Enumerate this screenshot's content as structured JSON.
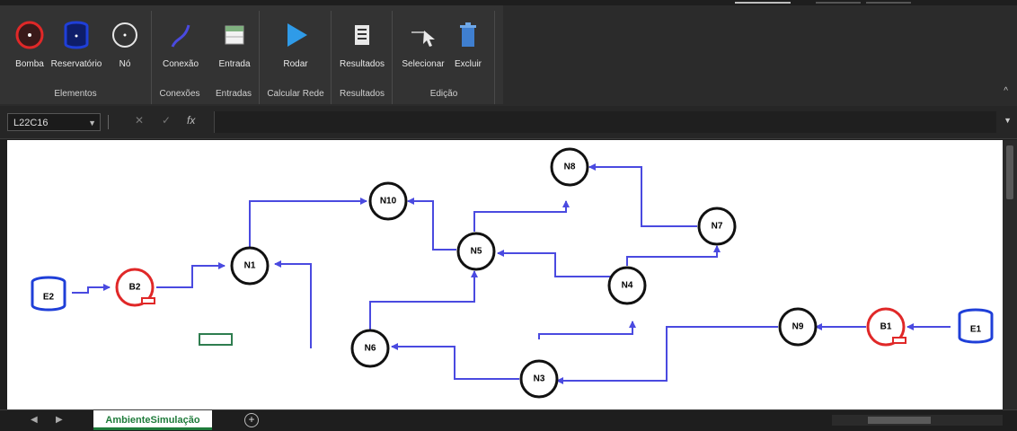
{
  "ribbon": {
    "groups": [
      {
        "label": "Elementos",
        "buttons": [
          {
            "label": "Bomba",
            "icon": "pump-icon"
          },
          {
            "label": "Reservatório",
            "icon": "reservoir-icon"
          },
          {
            "label": "Nó",
            "icon": "node-icon"
          }
        ]
      },
      {
        "label": "Conexões",
        "buttons": [
          {
            "label": "Conexão",
            "icon": "connection-icon"
          }
        ]
      },
      {
        "label": "Entradas",
        "buttons": [
          {
            "label": "Entrada",
            "icon": "input-table-icon"
          }
        ]
      },
      {
        "label": "Calcular Rede",
        "buttons": [
          {
            "label": "Rodar",
            "icon": "play-icon"
          }
        ]
      },
      {
        "label": "Resultados",
        "buttons": [
          {
            "label": "Resultados",
            "icon": "results-icon"
          }
        ]
      },
      {
        "label": "Edição",
        "buttons": [
          {
            "label": "Selecionar",
            "icon": "select-cursor-icon"
          },
          {
            "label": "Excluir",
            "icon": "delete-icon"
          }
        ]
      }
    ],
    "collapse_glyph": "^"
  },
  "formula_bar": {
    "name_box": "L22C16",
    "cancel_glyph": "✕",
    "enter_glyph": "✓",
    "fx_glyph": "fx",
    "value": ""
  },
  "diagram": {
    "colors": {
      "edge": "#4a4ae0",
      "reservoir": "#1f3fd8",
      "pump": "#e02828",
      "node": "#111111",
      "textbox": "#2e7d4f"
    },
    "reservoirs": [
      {
        "id": "E2",
        "label": "E2"
      },
      {
        "id": "E1",
        "label": "E1"
      }
    ],
    "pumps": [
      {
        "id": "B2",
        "label": "B2"
      },
      {
        "id": "B1",
        "label": "B1"
      }
    ],
    "nodes": [
      {
        "id": "N1",
        "label": "N1"
      },
      {
        "id": "N10",
        "label": "N10"
      },
      {
        "id": "N5",
        "label": "N5"
      },
      {
        "id": "N8",
        "label": "N8"
      },
      {
        "id": "N7",
        "label": "N7"
      },
      {
        "id": "N4",
        "label": "N4"
      },
      {
        "id": "N6",
        "label": "N6"
      },
      {
        "id": "N3",
        "label": "N3"
      },
      {
        "id": "N9",
        "label": "N9"
      }
    ]
  },
  "sheets": {
    "active": "AmbienteSimulação",
    "add_glyph": "+"
  }
}
